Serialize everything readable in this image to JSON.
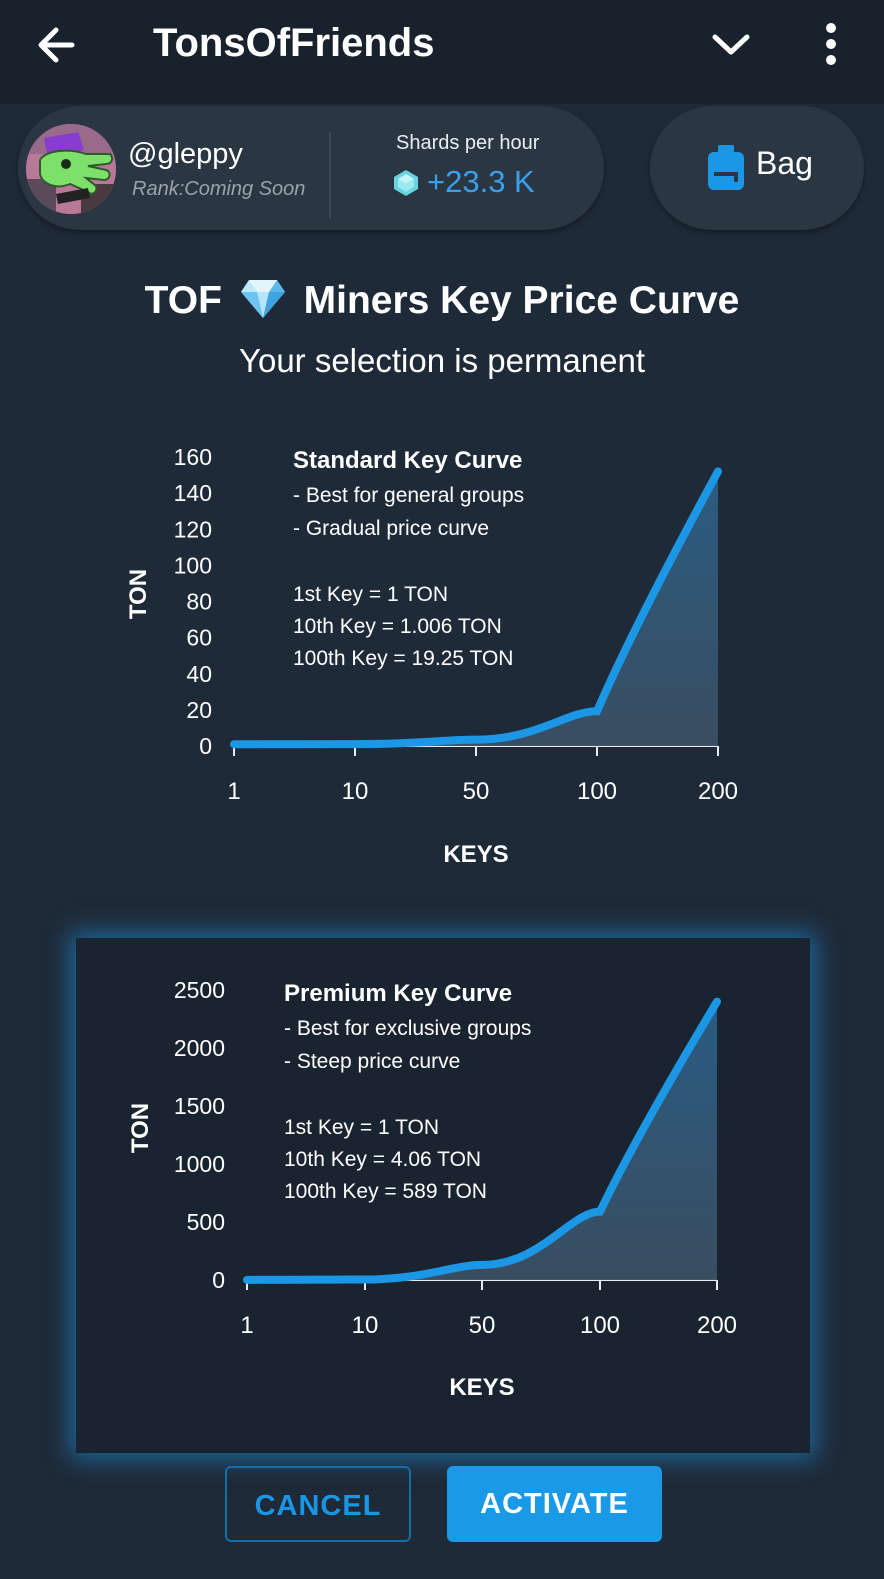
{
  "header": {
    "title": "TonsOfFriends",
    "back_icon": "arrow-left-icon",
    "menu_icons": [
      "chevron-down-icon",
      "more-vertical-icon"
    ]
  },
  "profile": {
    "username": "@gleppy",
    "rank": "Rank:Coming Soon",
    "shards_label": "Shards per hour",
    "shards_value": "+23.3 K",
    "shards_icon": "crystal-icon"
  },
  "bag": {
    "label": "Bag",
    "icon": "backpack-icon"
  },
  "page": {
    "title_before": "TOF",
    "title_after": "Miners Key Price Curve",
    "title_icon": "diamond-icon",
    "subtitle": "Your selection is permanent"
  },
  "colors": {
    "accent": "#1996e3",
    "background": "#1f2a38",
    "card": "#2b3643",
    "curve_line": "#1b97e5"
  },
  "chart_data": [
    {
      "type": "area",
      "name": "standard",
      "title": "Standard Key Curve",
      "notes": [
        "- Best for general groups",
        "- Gradual price curve"
      ],
      "key_prices": [
        "1st Key = 1 TON",
        "10th Key = 1.006 TON",
        "100th Key = 19.25 TON"
      ],
      "xlabel": "KEYS",
      "ylabel": "TON",
      "x_ticks": [
        "1",
        "10",
        "50",
        "100",
        "200"
      ],
      "y_ticks": [
        "0",
        "20",
        "40",
        "60",
        "80",
        "100",
        "120",
        "140",
        "160"
      ],
      "ylim": [
        0,
        160
      ],
      "x": [
        "1",
        "10",
        "50",
        "100",
        "200"
      ],
      "values": [
        1,
        1.006,
        3.5,
        19.25,
        152
      ],
      "selected": false
    },
    {
      "type": "area",
      "name": "premium",
      "title": "Premium Key Curve",
      "notes": [
        "- Best for exclusive groups",
        "- Steep price curve"
      ],
      "key_prices": [
        "1st Key = 1 TON",
        "10th Key = 4.06 TON",
        "100th Key = 589 TON"
      ],
      "xlabel": "KEYS",
      "ylabel": "TON",
      "x_ticks": [
        "1",
        "10",
        "50",
        "100",
        "200"
      ],
      "y_ticks": [
        "0",
        "500",
        "1000",
        "1500",
        "2000",
        "2500"
      ],
      "ylim": [
        0,
        2500
      ],
      "x": [
        "1",
        "10",
        "50",
        "100",
        "200"
      ],
      "values": [
        1,
        4.06,
        130,
        589,
        2400
      ],
      "selected": true
    }
  ],
  "actions": {
    "cancel": "CANCEL",
    "activate": "ACTIVATE"
  }
}
